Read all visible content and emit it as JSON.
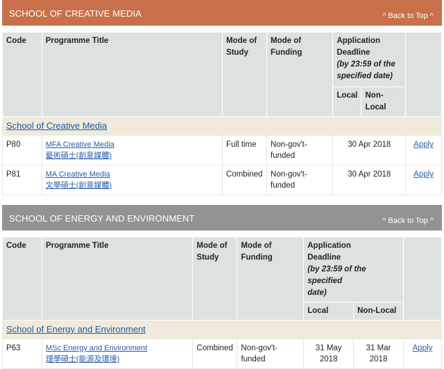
{
  "sections": [
    {
      "title": "SCHOOL OF CREATIVE MEDIA",
      "back_to_top": "^ Back to Top ^",
      "header_color": "#c8704a",
      "headers": {
        "code": "Code",
        "title": "Programme Title",
        "mode_l1": "Mode of",
        "mode_l2": "Study",
        "funding": "Mode of Funding",
        "deadline_l1": "Application",
        "deadline_l2": "Deadline",
        "deadline_note_l1": "(by 23:59 of the",
        "deadline_note_l2": "specified date)",
        "local": "Local",
        "non_local": "Non-Local"
      },
      "school_link": "School of Creative Media",
      "rows": [
        {
          "code": "P80",
          "title_en": "MFA Creative Media",
          "title_zh": "藝術碩士(創意媒體)",
          "mode": "Full time",
          "funding": "Non-gov't-funded",
          "deadline": "30 Apr 2018",
          "apply": "Apply"
        },
        {
          "code": "P81",
          "title_en": "MA Creative Media",
          "title_zh": "文學碩士(創意媒體)",
          "mode": "Combined",
          "funding": "Non-gov't-funded",
          "deadline": "30 Apr 2018",
          "apply": "Apply"
        }
      ]
    },
    {
      "title": "SCHOOL OF ENERGY AND ENVIRONMENT",
      "back_to_top": "^ Back to Top ^",
      "header_color": "#939393",
      "headers": {
        "code": "Code",
        "title": "Programme Title",
        "mode_l1": "Mode of",
        "mode_l2": "Study",
        "funding": "Mode of Funding",
        "deadline_l1": "Application",
        "deadline_l2": "Deadline",
        "deadline_note_l1": "(by 23:59 of the specified",
        "deadline_note_l2": "date)",
        "local": "Local",
        "non_local": "Non-Local"
      },
      "school_link": "School of Energy and Environment",
      "rows": [
        {
          "code": "P63",
          "title_en": "MSc Energy and Environment",
          "title_zh": "理學碩士(能源及環境)",
          "mode": "Combined",
          "funding": "Non-gov't-funded",
          "deadline_local": "31 May 2018",
          "deadline_non_local": "31 Mar 2018",
          "apply": "Apply"
        }
      ]
    }
  ]
}
